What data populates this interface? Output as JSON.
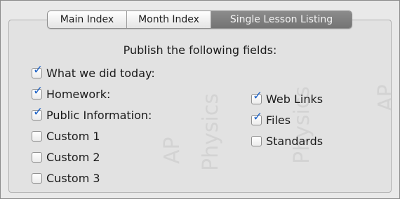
{
  "tabs": [
    {
      "label": "Main Index",
      "selected": false
    },
    {
      "label": "Month Index",
      "selected": false
    },
    {
      "label": "Single Lesson Listing",
      "selected": true
    }
  ],
  "heading": "Publish the following fields:",
  "left_fields": [
    {
      "label": "What we did today:",
      "checked": true
    },
    {
      "label": "Homework:",
      "checked": true
    },
    {
      "label": "Public Information:",
      "checked": true
    },
    {
      "label": "Custom 1",
      "checked": false
    },
    {
      "label": "Custom 2",
      "checked": false
    },
    {
      "label": "Custom 3",
      "checked": false
    }
  ],
  "right_fields": [
    {
      "label": "Web Links",
      "checked": true
    },
    {
      "label": "Files",
      "checked": true
    },
    {
      "label": "Standards",
      "checked": false
    }
  ],
  "colors": {
    "check": "#1f63c6",
    "selected_tab": "#7f7f7f"
  },
  "icons": {
    "checkmark": "checkmark-icon"
  }
}
